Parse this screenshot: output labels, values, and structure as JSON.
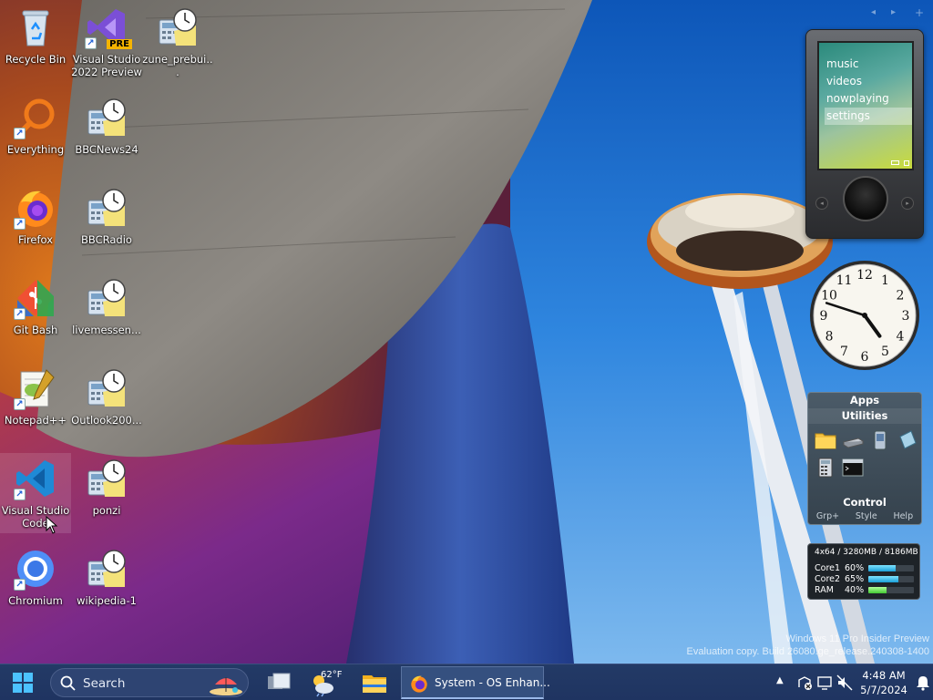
{
  "desktop": {
    "icons": [
      {
        "id": "recycle-bin",
        "label": "Recycle Bin",
        "icon": "recycle-bin-icon"
      },
      {
        "id": "visual-studio-2022-preview",
        "label": "Visual Studio 2022 Preview",
        "icon": "visual-studio-icon",
        "badge": "PRE"
      },
      {
        "id": "zune-prebuilt",
        "label": "zune_prebui...",
        "icon": "gadget-file-icon"
      },
      {
        "id": "everything",
        "label": "Everything",
        "icon": "everything-search-icon"
      },
      {
        "id": "bbcnews24",
        "label": "BBCNews24",
        "icon": "gadget-file-icon"
      },
      {
        "id": "firefox",
        "label": "Firefox",
        "icon": "firefox-icon"
      },
      {
        "id": "bbcradio",
        "label": "BBCRadio",
        "icon": "gadget-file-icon"
      },
      {
        "id": "git-bash",
        "label": "Git Bash",
        "icon": "git-bash-icon"
      },
      {
        "id": "livemessenger",
        "label": "livemessen...",
        "icon": "gadget-file-icon"
      },
      {
        "id": "notepad-plus-plus",
        "label": "Notepad++",
        "icon": "notepad-plus-plus-icon"
      },
      {
        "id": "outlook",
        "label": "Outlook200...",
        "icon": "gadget-file-icon"
      },
      {
        "id": "visual-studio-code",
        "label": "Visual Studio Code",
        "icon": "vscode-icon"
      },
      {
        "id": "ponzi",
        "label": "ponzi",
        "icon": "gadget-file-icon"
      },
      {
        "id": "chromium",
        "label": "Chromium",
        "icon": "chromium-icon"
      },
      {
        "id": "wikipedia-1",
        "label": "wikipedia-1",
        "icon": "gadget-file-icon"
      }
    ]
  },
  "gadgets": {
    "zune": {
      "menu": [
        "music",
        "videos",
        "nowplaying",
        "settings"
      ],
      "selected": "settings"
    },
    "clock": {
      "hour": 4,
      "minute": 48,
      "numerals": [
        "12",
        "1",
        "2",
        "3",
        "4",
        "5",
        "6",
        "7",
        "8",
        "9",
        "10",
        "11"
      ]
    },
    "apps": {
      "title": "Apps",
      "group": "Utilities",
      "items": [
        "folder-icon",
        "scanner-icon",
        "device-icon",
        "notepad-icon",
        "calculator-icon",
        "command-prompt-icon"
      ],
      "control_title": "Control",
      "links": [
        "Grp+",
        "Style",
        "Help"
      ]
    },
    "sysmon": {
      "header": "4x64 / 3280MB / 8186MB",
      "rows": [
        {
          "name": "Core1",
          "percent": "60%",
          "value": 0.6,
          "color": "#1b9fd8"
        },
        {
          "name": "Core2",
          "percent": "65%",
          "value": 0.65,
          "color": "#1b9fd8"
        },
        {
          "name": "RAM",
          "percent": "40%",
          "value": 0.4,
          "color": "#41c832"
        }
      ]
    }
  },
  "watermark": {
    "line1": "Windows 11 Pro Insider Preview",
    "line2": "Evaluation copy. Build 26080.ge_release.240308-1400"
  },
  "taskbar": {
    "search_placeholder": "Search",
    "weather_temp": "62°F",
    "active_window": "System - OS Enhan...",
    "time": "4:48 AM",
    "date": "5/7/2024"
  }
}
